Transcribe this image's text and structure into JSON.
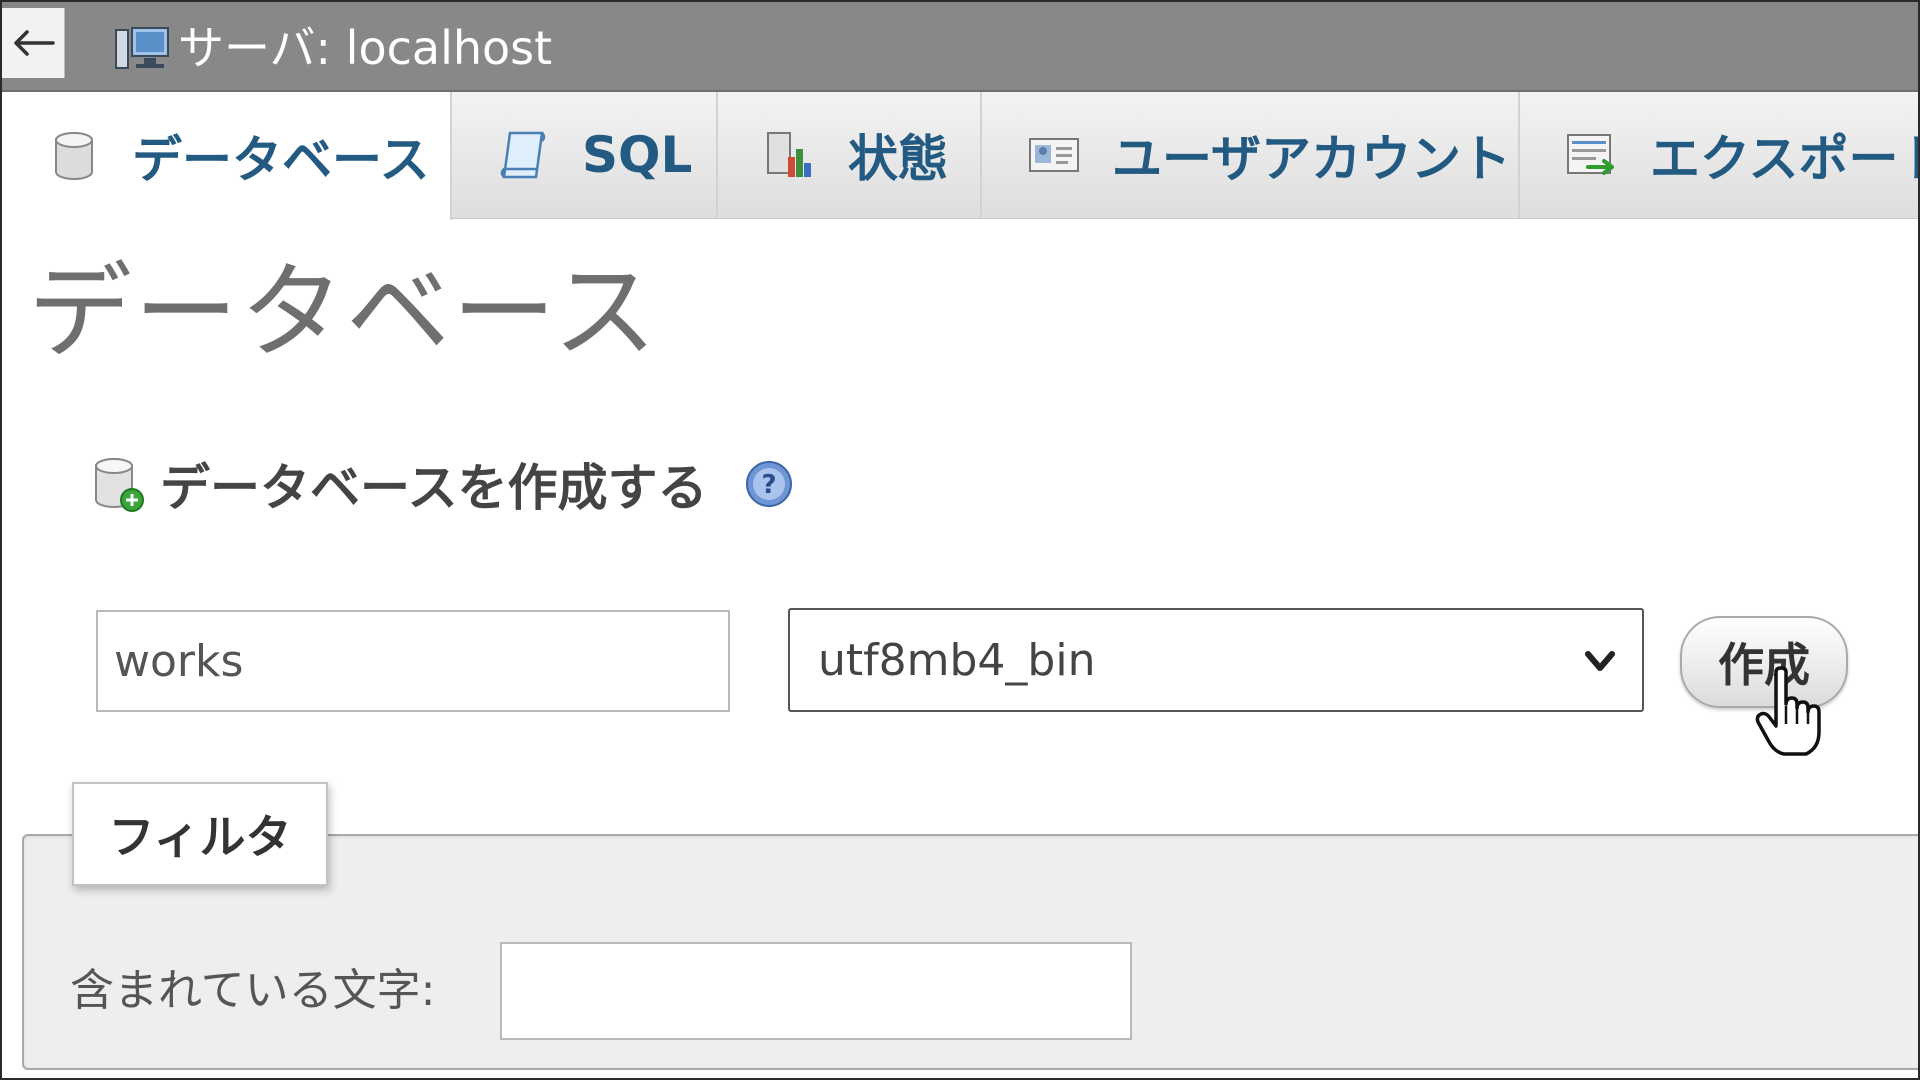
{
  "topbar": {
    "back_glyph": "←",
    "server_title": "サーバ: localhost",
    "server_icon": "server-icon"
  },
  "tabs": [
    {
      "label": "データベース",
      "icon": "database-icon",
      "active": true
    },
    {
      "label": "SQL",
      "icon": "sql-icon",
      "active": false
    },
    {
      "label": "状態",
      "icon": "status-icon",
      "active": false
    },
    {
      "label": "ユーザアカウント",
      "icon": "user-accounts-icon",
      "active": false
    },
    {
      "label": "エクスポート",
      "icon": "export-icon",
      "active": false
    }
  ],
  "page": {
    "title": "データベース"
  },
  "create_db": {
    "heading": "データベースを作成する",
    "name_value": "works",
    "collation_selected": "utf8mb4_bin",
    "create_label": "作成"
  },
  "filter": {
    "legend": "フィルタ",
    "contains_label": "含まれている文字:",
    "contains_value": ""
  },
  "colors": {
    "topbar_bg": "#888888",
    "tab_text": "#235a81",
    "title_text": "#6f6f6f"
  }
}
